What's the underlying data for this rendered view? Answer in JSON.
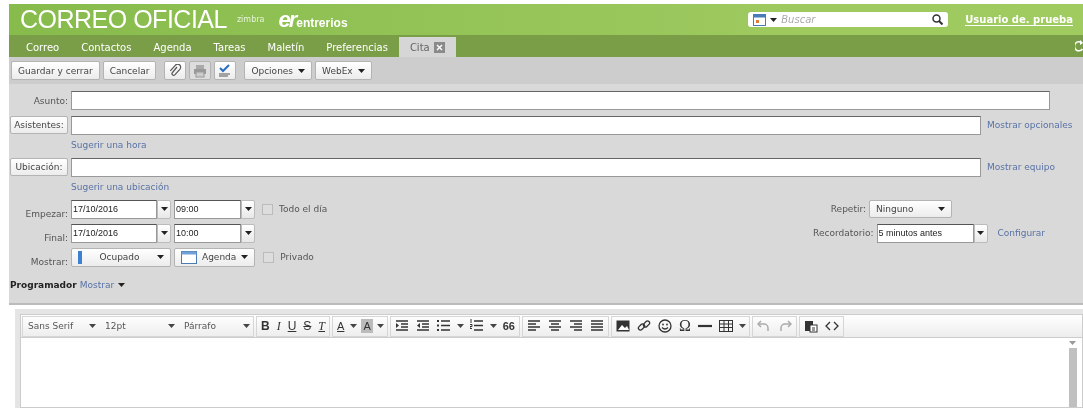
{
  "header": {
    "title": "CORREO OFICIAL",
    "zimbra": "zimbra",
    "logo_mark": "er",
    "logo_text": "entrerios",
    "search": {
      "placeholder": "Buscar"
    },
    "user": "Usuario de. prueba"
  },
  "tabs": [
    {
      "label": "Correo",
      "selected": false
    },
    {
      "label": "Contactos",
      "selected": false
    },
    {
      "label": "Agenda",
      "selected": false
    },
    {
      "label": "Tareas",
      "selected": false
    },
    {
      "label": "Maletín",
      "selected": false
    },
    {
      "label": "Preferencias",
      "selected": false
    },
    {
      "label": "Cita",
      "selected": true,
      "closable": true
    }
  ],
  "toolbar": [
    {
      "kind": "button",
      "label": "Guardar y cerrar"
    },
    {
      "kind": "button",
      "label": "Cancelar"
    },
    {
      "kind": "icon",
      "disabled": false
    },
    {
      "kind": "icon",
      "disabled": true
    },
    {
      "kind": "icon",
      "disabled": false
    },
    {
      "kind": "menu",
      "label": "Opciones"
    },
    {
      "kind": "menu",
      "label": "WebEx"
    }
  ],
  "form": {
    "subject": {
      "label": "Asunto:"
    },
    "attendees": {
      "label": "Asistentes:",
      "link": "Mostrar opcionales",
      "suggest": "Sugerir una hora"
    },
    "location": {
      "label": "Ubicación:",
      "link": "Mostrar equipo",
      "suggest": "Sugerir una ubicación"
    },
    "start": {
      "label": "Empezar:",
      "date": "17/10/2016",
      "time": "09:00"
    },
    "end": {
      "label": "Final:",
      "date": "17/10/2016",
      "time": "10:00"
    },
    "all_day": {
      "label": "Todo el día",
      "checked": false
    },
    "repeat": {
      "label": "Repetir:",
      "value": "Ninguno"
    },
    "reminder": {
      "label": "Recordatorio:",
      "value": "5 minutos antes",
      "link": "Configurar"
    },
    "show": {
      "label": "Mostrar:",
      "value": "Ocupado",
      "calendar": "Agenda"
    },
    "private": {
      "label": "Privado",
      "checked": false
    },
    "scheduler": {
      "label": "Programador",
      "link": "Mostrar"
    }
  },
  "editor": {
    "font": "Sans Serif",
    "size": "12pt",
    "format": "Párrafo",
    "tools": [
      {
        "kind": "glyph",
        "label": "B"
      },
      {
        "kind": "glyph",
        "label": "I"
      },
      {
        "kind": "glyph",
        "label": "U"
      },
      {
        "kind": "glyph",
        "label": "S"
      },
      {
        "kind": "glyph",
        "label": "T"
      },
      {
        "kind": "sep"
      },
      {
        "kind": "glyph",
        "label": "A"
      },
      {
        "kind": "caret"
      },
      {
        "kind": "glyph",
        "label": "A"
      },
      {
        "kind": "caret"
      },
      {
        "kind": "sep"
      },
      {
        "kind": "icon"
      },
      {
        "kind": "icon"
      },
      {
        "kind": "icon"
      },
      {
        "kind": "caret"
      },
      {
        "kind": "icon"
      },
      {
        "kind": "caret"
      },
      {
        "kind": "glyph",
        "label": "66"
      },
      {
        "kind": "sep"
      },
      {
        "kind": "icon"
      },
      {
        "kind": "icon"
      },
      {
        "kind": "icon"
      },
      {
        "kind": "icon"
      },
      {
        "kind": "sep"
      },
      {
        "kind": "icon"
      },
      {
        "kind": "icon"
      },
      {
        "kind": "icon"
      },
      {
        "kind": "glyph",
        "label": "Ω"
      },
      {
        "kind": "icon"
      },
      {
        "kind": "icon"
      },
      {
        "kind": "caret"
      },
      {
        "kind": "sep"
      },
      {
        "kind": "icon",
        "disabled": true
      },
      {
        "kind": "icon",
        "disabled": true
      },
      {
        "kind": "sep"
      },
      {
        "kind": "icon"
      },
      {
        "kind": "icon"
      }
    ]
  }
}
